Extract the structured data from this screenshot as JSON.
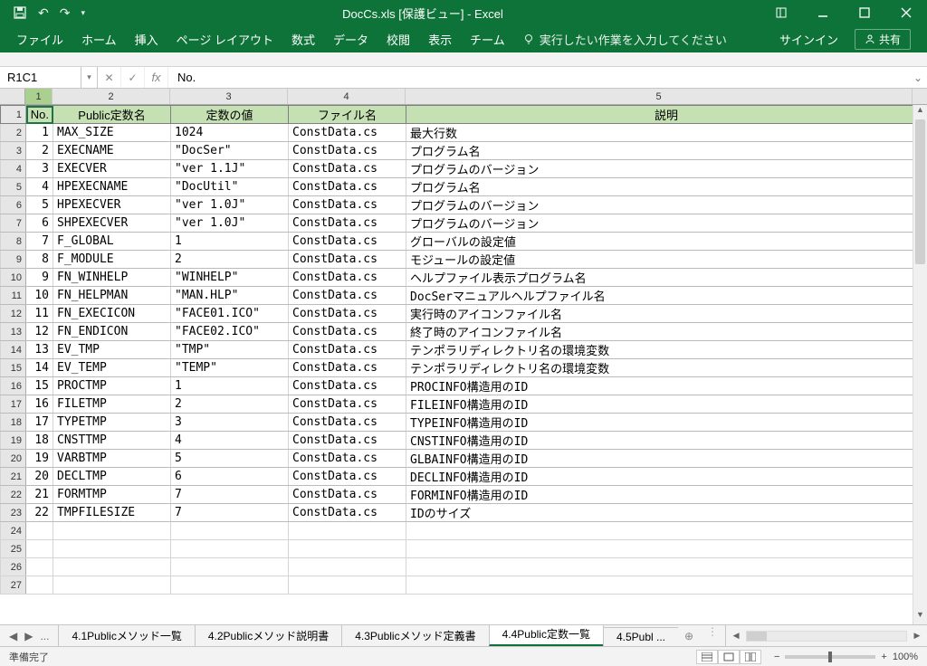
{
  "title": "DocCs.xls  [保護ビュー] - Excel",
  "qat": {
    "undo": "↶",
    "redo": "↷"
  },
  "ribbon": {
    "tabs": [
      "ファイル",
      "ホーム",
      "挿入",
      "ページ レイアウト",
      "数式",
      "データ",
      "校閲",
      "表示",
      "チーム"
    ],
    "tellme_placeholder": "実行したい作業を入力してください",
    "signin": "サインイン",
    "share": "共有"
  },
  "formula_bar": {
    "name_box": "R1C1",
    "value": "No."
  },
  "col_headers": [
    "1",
    "2",
    "3",
    "4",
    "5"
  ],
  "header_row": [
    "No.",
    "Public定数名",
    "定数の値",
    "ファイル名",
    "説明"
  ],
  "rows": [
    {
      "no": "1",
      "name": "MAX_SIZE",
      "val": "1024",
      "file": "ConstData.cs",
      "desc": "最大行数"
    },
    {
      "no": "2",
      "name": "EXECNAME",
      "val": "\"DocSer\"",
      "file": "ConstData.cs",
      "desc": "プログラム名"
    },
    {
      "no": "3",
      "name": "EXECVER",
      "val": "\"ver 1.1J\"",
      "file": "ConstData.cs",
      "desc": "プログラムのバージョン"
    },
    {
      "no": "4",
      "name": "HPEXECNAME",
      "val": "\"DocUtil\"",
      "file": "ConstData.cs",
      "desc": "プログラム名"
    },
    {
      "no": "5",
      "name": "HPEXECVER",
      "val": "\"ver 1.0J\"",
      "file": "ConstData.cs",
      "desc": "プログラムのバージョン"
    },
    {
      "no": "6",
      "name": "SHPEXECVER",
      "val": "\"ver 1.0J\"",
      "file": "ConstData.cs",
      "desc": "プログラムのバージョン"
    },
    {
      "no": "7",
      "name": "F_GLOBAL",
      "val": "1",
      "file": "ConstData.cs",
      "desc": "グローバルの設定値"
    },
    {
      "no": "8",
      "name": "F_MODULE",
      "val": "2",
      "file": "ConstData.cs",
      "desc": "モジュールの設定値"
    },
    {
      "no": "9",
      "name": "FN_WINHELP",
      "val": "\"WINHELP\"",
      "file": "ConstData.cs",
      "desc": "ヘルプファイル表示プログラム名"
    },
    {
      "no": "10",
      "name": "FN_HELPMAN",
      "val": "\"MAN.HLP\"",
      "file": "ConstData.cs",
      "desc": "DocSerマニュアルヘルプファイル名"
    },
    {
      "no": "11",
      "name": "FN_EXECICON",
      "val": "\"FACE01.ICO\"",
      "file": "ConstData.cs",
      "desc": "実行時のアイコンファイル名"
    },
    {
      "no": "12",
      "name": "FN_ENDICON",
      "val": "\"FACE02.ICO\"",
      "file": "ConstData.cs",
      "desc": "終了時のアイコンファイル名"
    },
    {
      "no": "13",
      "name": "EV_TMP",
      "val": "\"TMP\"",
      "file": "ConstData.cs",
      "desc": "テンポラリディレクトリ名の環境変数"
    },
    {
      "no": "14",
      "name": "EV_TEMP",
      "val": "\"TEMP\"",
      "file": "ConstData.cs",
      "desc": "テンポラリディレクトリ名の環境変数"
    },
    {
      "no": "15",
      "name": "PROCTMP",
      "val": "1",
      "file": "ConstData.cs",
      "desc": "PROCINFO構造用のID"
    },
    {
      "no": "16",
      "name": "FILETMP",
      "val": "2",
      "file": "ConstData.cs",
      "desc": "FILEINFO構造用のID"
    },
    {
      "no": "17",
      "name": "TYPETMP",
      "val": "3",
      "file": "ConstData.cs",
      "desc": "TYPEINFO構造用のID"
    },
    {
      "no": "18",
      "name": "CNSTTMP",
      "val": "4",
      "file": "ConstData.cs",
      "desc": "CNSTINFO構造用のID"
    },
    {
      "no": "19",
      "name": "VARBTMP",
      "val": "5",
      "file": "ConstData.cs",
      "desc": "GLBAINFO構造用のID"
    },
    {
      "no": "20",
      "name": "DECLTMP",
      "val": "6",
      "file": "ConstData.cs",
      "desc": "DECLINFO構造用のID"
    },
    {
      "no": "21",
      "name": "FORMTMP",
      "val": "7",
      "file": "ConstData.cs",
      "desc": "FORMINFO構造用のID"
    },
    {
      "no": "22",
      "name": "TMPFILESIZE",
      "val": "7",
      "file": "ConstData.cs",
      "desc": "IDのサイズ"
    }
  ],
  "empty_rows": [
    24,
    25,
    26,
    27
  ],
  "sheet_tabs": {
    "prefix_ellipsis": "...",
    "list": [
      "4.1Publicメソッド一覧",
      "4.2Publicメソッド説明書",
      "4.3Publicメソッド定義書",
      "4.4Public定数一覧",
      "4.5Publ ..."
    ],
    "active_index": 3
  },
  "status": {
    "left": "準備完了",
    "zoom": "100%"
  }
}
